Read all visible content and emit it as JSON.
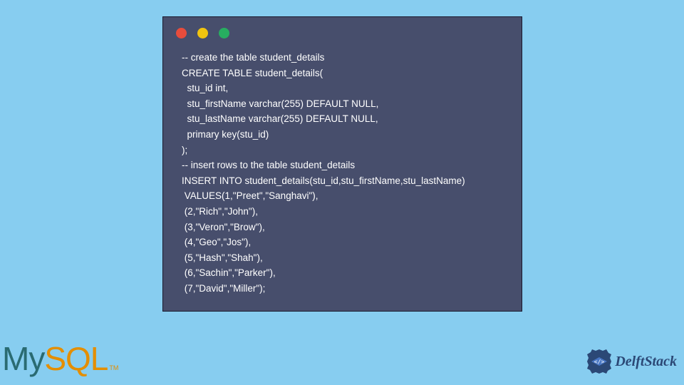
{
  "code": {
    "lines": [
      "-- create the table student_details",
      "CREATE TABLE student_details(",
      "  stu_id int,",
      "  stu_firstName varchar(255) DEFAULT NULL,",
      "  stu_lastName varchar(255) DEFAULT NULL,",
      "  primary key(stu_id)",
      ");",
      "-- insert rows to the table student_details",
      "INSERT INTO student_details(stu_id,stu_firstName,stu_lastName)",
      " VALUES(1,\"Preet\",\"Sanghavi\"),",
      " (2,\"Rich\",\"John\"),",
      " (3,\"Veron\",\"Brow\"),",
      " (4,\"Geo\",\"Jos\"),",
      " (5,\"Hash\",\"Shah\"),",
      " (6,\"Sachin\",\"Parker\"),",
      " (7,\"David\",\"Miller\");"
    ]
  },
  "logos": {
    "mysql": {
      "my": "My",
      "sql": "SQL",
      "tm": "TM"
    },
    "delftstack": {
      "text": "DelftStack"
    }
  }
}
